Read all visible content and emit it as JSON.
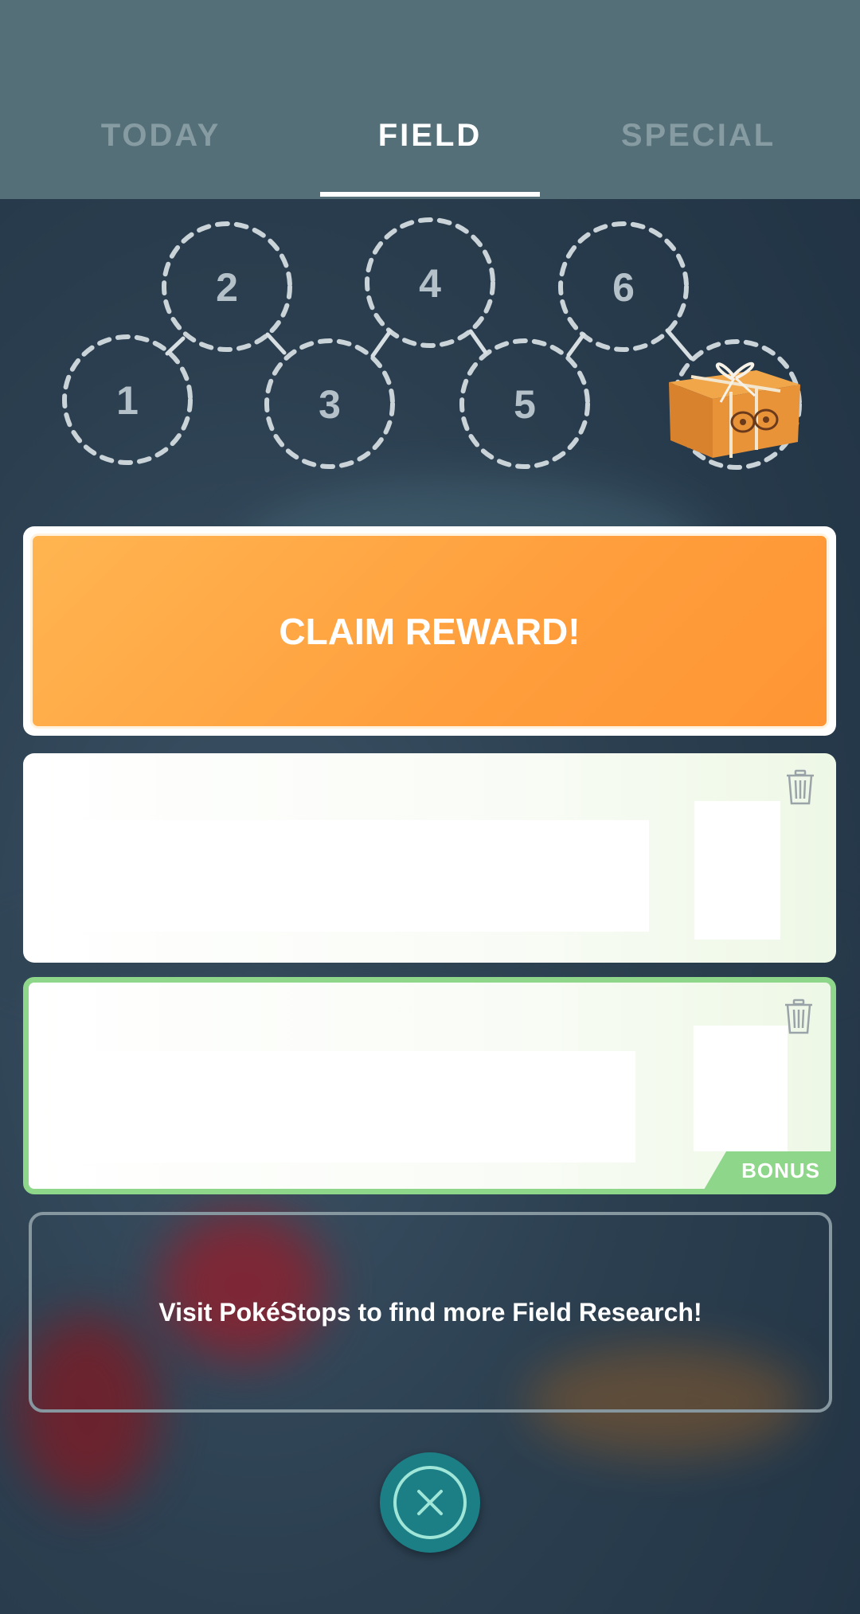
{
  "tabs": [
    {
      "label": "TODAY",
      "active": false
    },
    {
      "label": "FIELD",
      "active": true
    },
    {
      "label": "SPECIAL",
      "active": false
    }
  ],
  "stamps": {
    "labels": [
      "1",
      "2",
      "3",
      "4",
      "5",
      "6"
    ],
    "completed": 0,
    "reward_icon": "research-breakthrough-box-icon"
  },
  "claim": {
    "label": "CLAIM REWARD!"
  },
  "tasks": [
    {
      "bonus": false,
      "trash_icon": "trash-icon"
    },
    {
      "bonus": true,
      "bonus_label": "BONUS",
      "trash_icon": "trash-icon"
    }
  ],
  "notice": {
    "text": "Visit PokéStops to find more Field Research!"
  },
  "close": {
    "icon": "close-icon"
  },
  "colors": {
    "header": "#546f78",
    "active_tab": "#ffffff",
    "inactive_tab": "#869ba2",
    "claim_orange": "#ff9e3c",
    "bonus_green": "#8ed68a",
    "close_teal": "#1d7f86"
  }
}
